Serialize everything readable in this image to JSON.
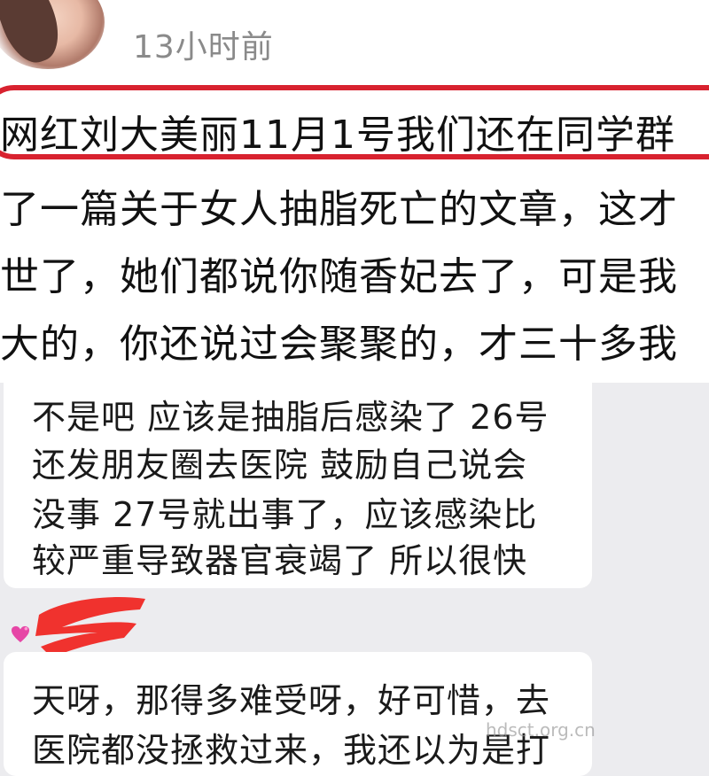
{
  "post": {
    "timestamp": "13小时前",
    "article_lines": [
      "网红刘大美丽11月1号我们还在同学群",
      "了一篇关于女人抽脂死亡的文章，这才",
      "世了，她们都说你随香妃去了，可是我",
      "大的，你还说过会聚聚的，才三十多我"
    ]
  },
  "replies": [
    {
      "lines": [
        "不是吧 应该是抽脂后感染了 26号",
        "还发朋友圈去医院 鼓励自己说会",
        "没事 27号就出事了，应该感染比",
        "较严重导致器官衰竭了 所以很快"
      ]
    },
    {
      "lines": [
        "天呀，那得多难受呀，好可惜，去",
        "医院都没拯救过来，我还以为是打"
      ]
    }
  ],
  "watermark": "hdsct.org.cn",
  "colors": {
    "highlight": "#d8222f",
    "redaction": "#f0322e",
    "background": "#ececef"
  },
  "icons": [
    "avatar",
    "heart-icon",
    "redaction-scribble"
  ]
}
